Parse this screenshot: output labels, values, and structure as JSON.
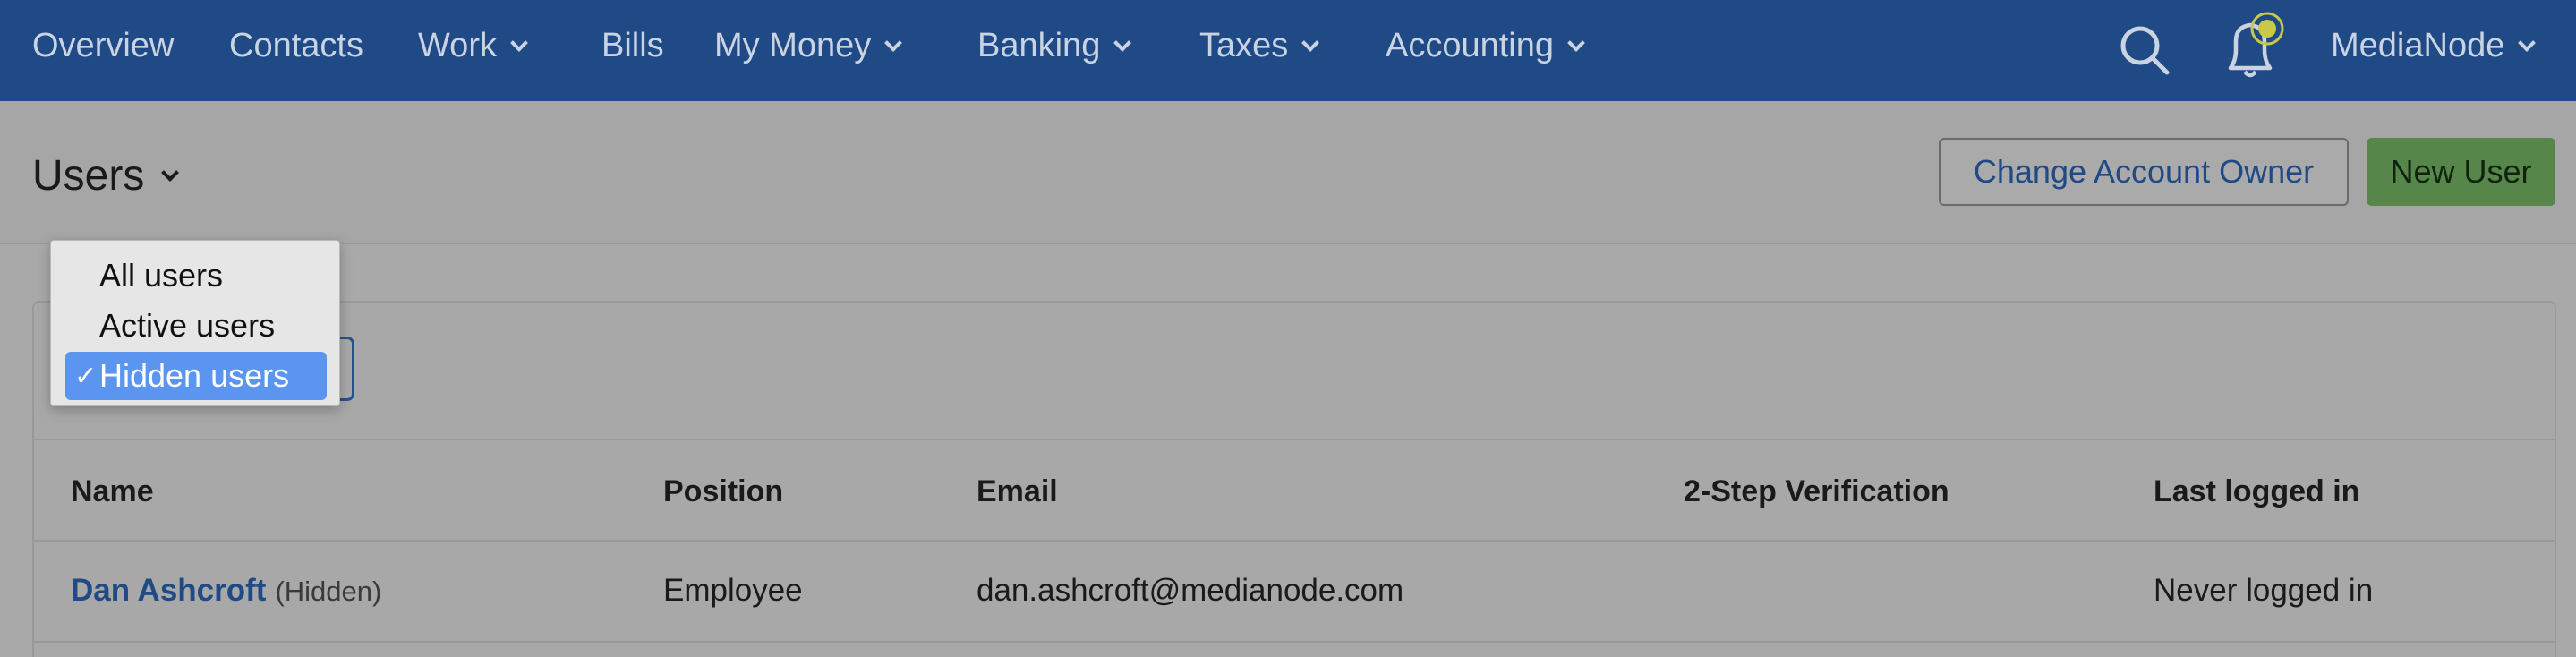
{
  "nav": {
    "items": [
      {
        "label": "Overview",
        "dropdown": false
      },
      {
        "label": "Contacts",
        "dropdown": false
      },
      {
        "label": "Work",
        "dropdown": true
      },
      {
        "label": "Bills",
        "dropdown": false
      },
      {
        "label": "My Money",
        "dropdown": true
      },
      {
        "label": "Banking",
        "dropdown": true
      },
      {
        "label": "Taxes",
        "dropdown": true
      },
      {
        "label": "Accounting",
        "dropdown": true
      }
    ],
    "account_label": "MediaNode",
    "icons": [
      "search-icon",
      "bell-icon",
      "chevron-down-icon"
    ]
  },
  "header": {
    "title": "Users",
    "change_owner_label": "Change Account Owner",
    "new_user_label": "New User"
  },
  "filter_menu": {
    "options": [
      "All users",
      "Active users",
      "Hidden users"
    ],
    "selected": "Hidden users",
    "check_glyph": "✓"
  },
  "table": {
    "columns": [
      "Name",
      "Position",
      "Email",
      "2-Step Verification",
      "Last logged in"
    ],
    "rows": [
      {
        "name": "Dan Ashcroft",
        "tag": "(Hidden)",
        "position": "Employee",
        "email": "dan.ashcroft@medianode.com",
        "two_step": "",
        "last_logged_in": "Never logged in"
      }
    ]
  },
  "colors": {
    "nav_bg": "#1f4a85",
    "link": "#1f4a85",
    "primary_button": "#56864a",
    "selected_item": "#5b95f0",
    "notification_accent": "#c8c94a"
  }
}
